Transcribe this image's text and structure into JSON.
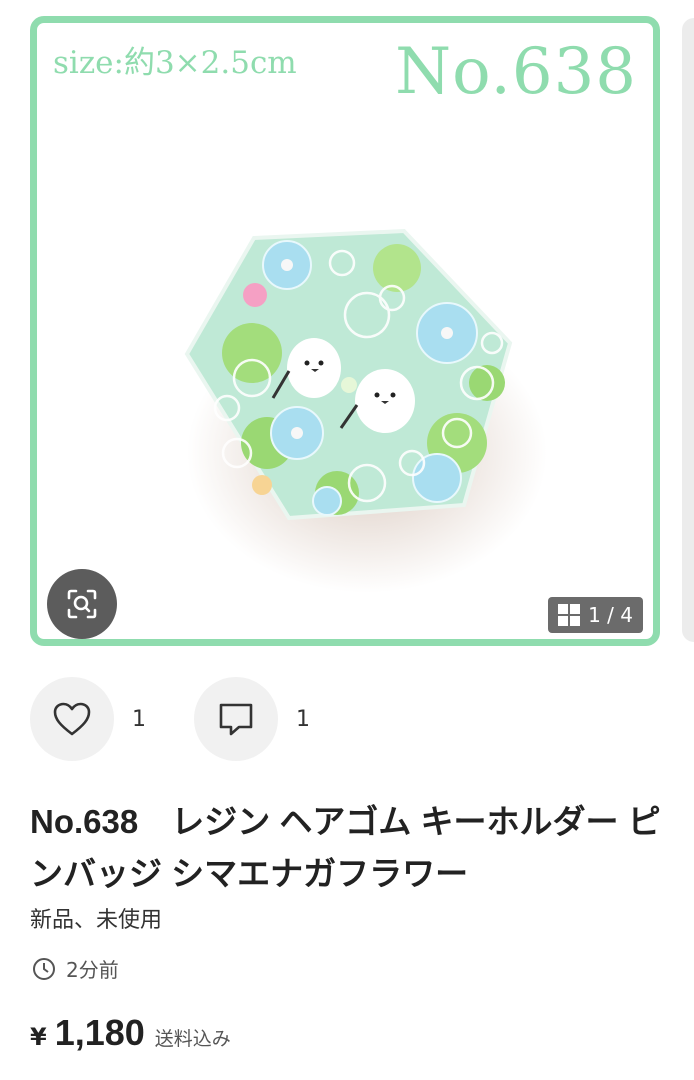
{
  "image": {
    "size_text": "size:約3×2.5cm",
    "number_text": "No.638",
    "counter": "1 / 4",
    "accent_color": "#8fdcae"
  },
  "icons": {
    "zoom": "lens-scan-icon",
    "gallery_grid": "grid-icon",
    "like": "heart-icon",
    "comment": "comment-icon",
    "time": "clock-icon"
  },
  "actions": {
    "likes": "1",
    "comments": "1"
  },
  "product": {
    "title": "No.638　レジン ヘアゴム キーホルダー ピンバッジ シマエナガフラワー",
    "condition": "新品、未使用",
    "posted": "2分前",
    "price_symbol": "¥",
    "price": "1,180",
    "shipping": "送料込み"
  }
}
